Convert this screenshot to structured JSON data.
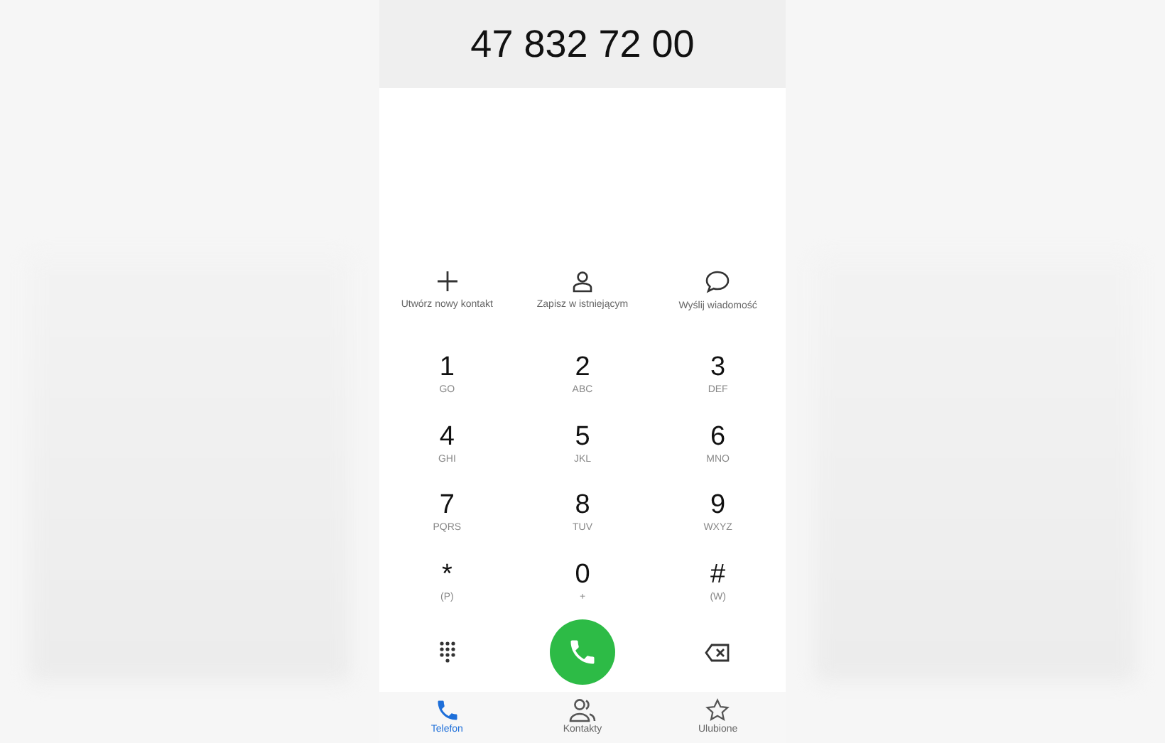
{
  "number": "47 832 72 00",
  "actions": [
    {
      "label": "Utwórz nowy kontakt"
    },
    {
      "label": "Zapisz w istniejącym"
    },
    {
      "label": "Wyślij wiadomość"
    }
  ],
  "keys": [
    {
      "digit": "1",
      "letters": "GO"
    },
    {
      "digit": "2",
      "letters": "ABC"
    },
    {
      "digit": "3",
      "letters": "DEF"
    },
    {
      "digit": "4",
      "letters": "GHI"
    },
    {
      "digit": "5",
      "letters": "JKL"
    },
    {
      "digit": "6",
      "letters": "MNO"
    },
    {
      "digit": "7",
      "letters": "PQRS"
    },
    {
      "digit": "8",
      "letters": "TUV"
    },
    {
      "digit": "9",
      "letters": "WXYZ"
    },
    {
      "digit": "*",
      "letters": "(P)"
    },
    {
      "digit": "0",
      "letters": "+"
    },
    {
      "digit": "#",
      "letters": "(W)"
    }
  ],
  "nav": [
    {
      "label": "Telefon",
      "selected": true
    },
    {
      "label": "Kontakty",
      "selected": false
    },
    {
      "label": "Ulubione",
      "selected": false
    }
  ]
}
